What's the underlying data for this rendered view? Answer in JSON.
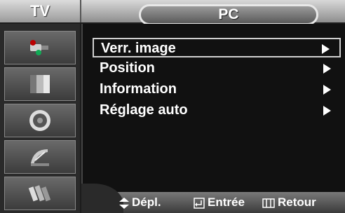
{
  "header": {
    "left_tab": "TV",
    "title": "PC"
  },
  "sidebar": {
    "icons": [
      "input-plug-icon",
      "picture-panel-icon",
      "speaker-icon",
      "satellite-dish-icon",
      "setup-plugs-icon"
    ]
  },
  "menu": {
    "items": [
      {
        "label": "Verr. image",
        "selected": true
      },
      {
        "label": "Position",
        "selected": false
      },
      {
        "label": "Information",
        "selected": false
      },
      {
        "label": "Réglage auto",
        "selected": false
      }
    ]
  },
  "footer": {
    "move_label": "Dépl.",
    "enter_label": "Entrée",
    "return_label": "Retour"
  }
}
